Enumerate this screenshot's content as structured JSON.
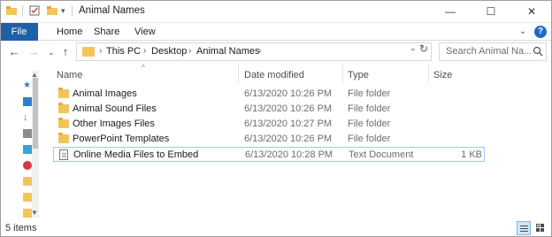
{
  "window": {
    "title": "Animal Names",
    "controls": {
      "minimize": "—",
      "maximize": "☐",
      "close": "✕"
    }
  },
  "ribbon": {
    "tabs": [
      {
        "label": "File",
        "active": true
      },
      {
        "label": "Home"
      },
      {
        "label": "Share"
      },
      {
        "label": "View"
      }
    ],
    "help_label": "?",
    "expand_icon": "chevron-down-icon"
  },
  "navigation": {
    "back": "←",
    "forward": "→",
    "recent": "⌄",
    "up": "↑",
    "breadcrumb": [
      "This PC",
      "Desktop",
      "Animal Names"
    ],
    "separator": "›",
    "refresh": "↻"
  },
  "search": {
    "placeholder": "Search Animal Na..."
  },
  "columns": {
    "name": "Name",
    "date_modified": "Date modified",
    "type": "Type",
    "size": "Size"
  },
  "files": [
    {
      "name": "Animal Images",
      "date_modified": "6/13/2020 10:26 PM",
      "type": "File folder",
      "size": "",
      "kind": "folder"
    },
    {
      "name": "Animal Sound Files",
      "date_modified": "6/13/2020 10:26 PM",
      "type": "File folder",
      "size": "",
      "kind": "folder"
    },
    {
      "name": "Other Images Files",
      "date_modified": "6/13/2020 10:27 PM",
      "type": "File folder",
      "size": "",
      "kind": "folder"
    },
    {
      "name": "PowerPoint Templates",
      "date_modified": "6/13/2020 10:26 PM",
      "type": "File folder",
      "size": "",
      "kind": "folder"
    },
    {
      "name": "Online Media Files to Embed",
      "date_modified": "6/13/2020 10:28 PM",
      "type": "Text Document",
      "size": "1 KB",
      "kind": "text",
      "selected": true
    }
  ],
  "status": {
    "item_count": "5 items"
  },
  "colors": {
    "file_tab": "#1f5fa8",
    "folder": "#f2c55c",
    "selection_border": "#99c9ef"
  }
}
